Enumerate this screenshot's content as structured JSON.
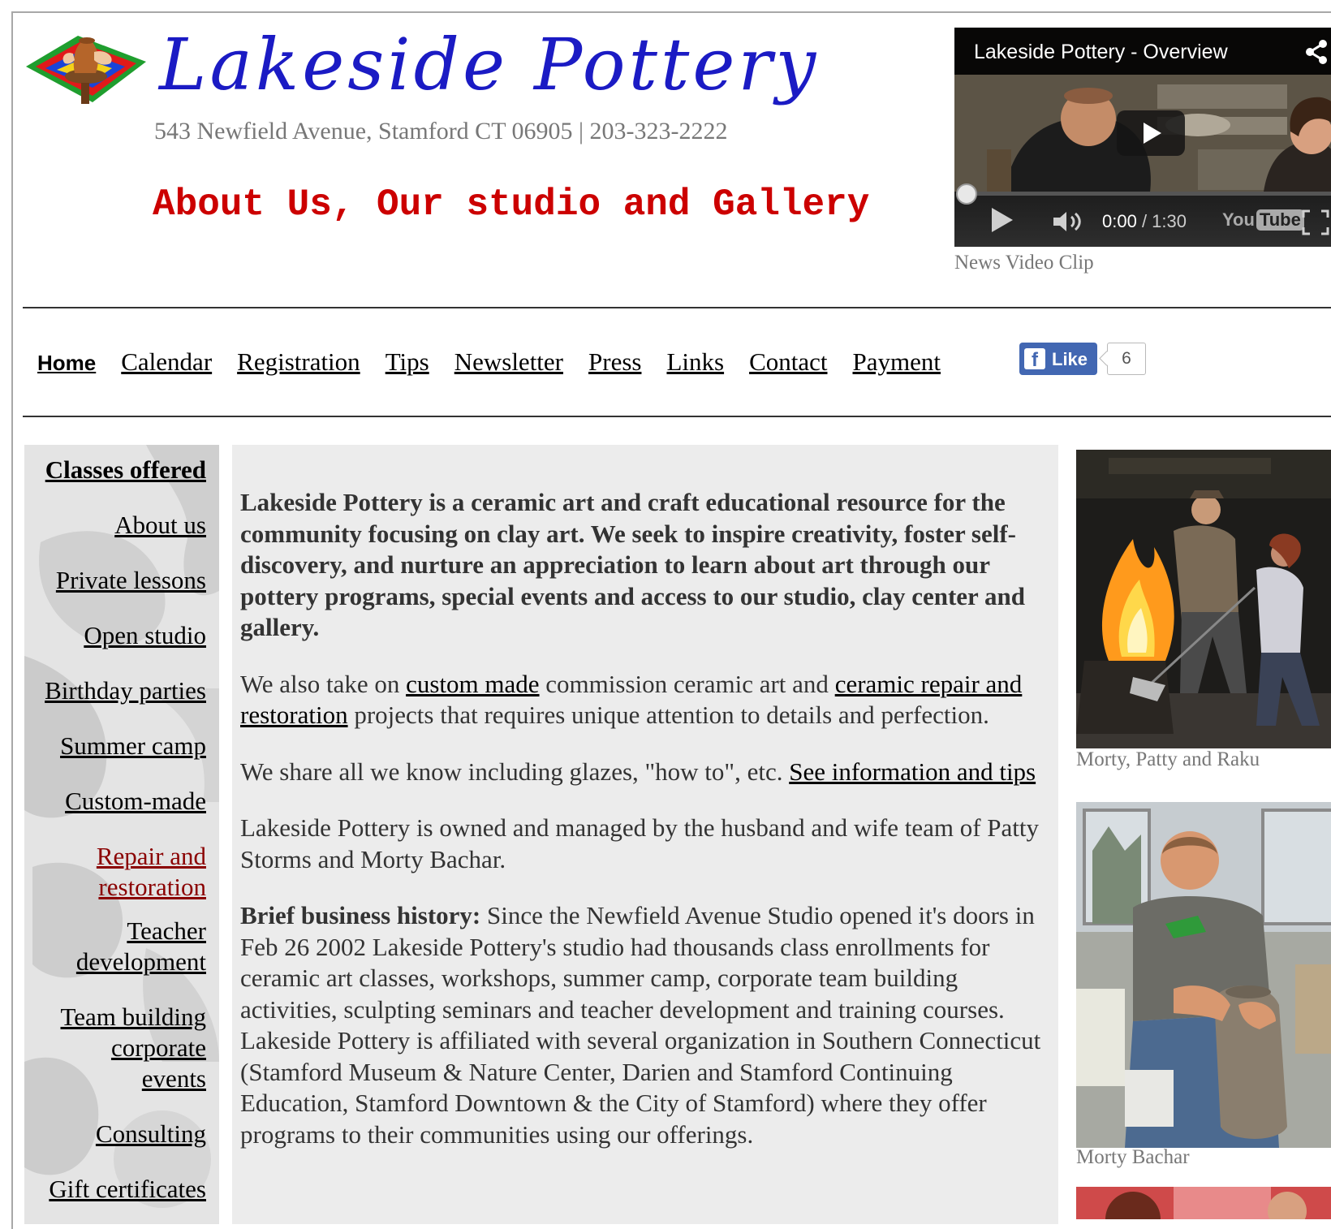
{
  "header": {
    "site_title": "Lakeside Pottery",
    "address": "543 Newfield Avenue, Stamford CT 06905 | 203-323-2222",
    "page_heading": "About Us, Our studio and Gallery"
  },
  "video": {
    "title": "Lakeside Pottery - Overview",
    "time_current": "0:00",
    "time_total": " / 1:30",
    "logo_you": "You",
    "logo_tube": "Tube",
    "caption": "News Video Clip",
    "progress": 0
  },
  "nav": {
    "items": [
      "Home",
      "Calendar",
      "Registration",
      "Tips",
      "Newsletter",
      "Press",
      "Links",
      "Contact",
      "Payment"
    ],
    "like_label": "Like",
    "like_count": "6"
  },
  "sidebar": {
    "items": [
      {
        "label": "Classes offered"
      },
      {
        "label": "About us"
      },
      {
        "label": "Private lessons"
      },
      {
        "label": "Open studio"
      },
      {
        "label": "Birthday parties"
      },
      {
        "label": "Summer camp"
      },
      {
        "label": "Custom-made"
      },
      {
        "label_line1": "Repair and",
        "label_line2": "restoration"
      },
      {
        "label_line1": "Teacher",
        "label_line2": "development"
      },
      {
        "label_line1": "Team building",
        "label_line2": "corporate",
        "label_line3": "events"
      },
      {
        "label": "Consulting"
      },
      {
        "label": "Gift certificates"
      }
    ]
  },
  "content": {
    "intro": "Lakeside Pottery is a ceramic art and craft educational resource for the community focusing on clay art. We seek to inspire creativity, foster self-discovery, and nurture an appreciation to learn about art through our pottery programs, special events and access to our studio, clay center and gallery.",
    "p2_before": "We also take on ",
    "p2_link1": "custom made",
    "p2_middle": " commission ceramic art and ",
    "p2_link2": "ceramic repair and restoration",
    "p2_after": " projects that requires unique attention to details and perfection.",
    "p3_before": "We share all we know including glazes, \"how to\", etc. ",
    "p3_link": "See information and tips",
    "p4": "Lakeside Pottery is owned and managed by the husband and wife team of Patty Storms and Morty Bachar.",
    "p5_label": "Brief business history:",
    "p5_text": " Since the Newfield Avenue Studio opened it's doors in Feb 26 2002 Lakeside Pottery's studio had thousands class enrollments for ceramic art classes, workshops, summer camp, corporate team building activities, sculpting seminars and teacher development and training courses. Lakeside Pottery is affiliated with several organization in Southern Connecticut (Stamford Museum & Nature Center, Darien and Stamford Continuing Education, Stamford Downtown & the City of Stamford) where they offer programs to their communities using our offerings."
  },
  "photos": {
    "caption1": "Morty, Patty and Raku",
    "caption2": "Morty Bachar"
  },
  "colors": {
    "title_blue": "#1b1bc4",
    "heading_red": "#cc0000",
    "facebook_blue": "#4267b2",
    "active_sidebar": "#8a0000"
  }
}
